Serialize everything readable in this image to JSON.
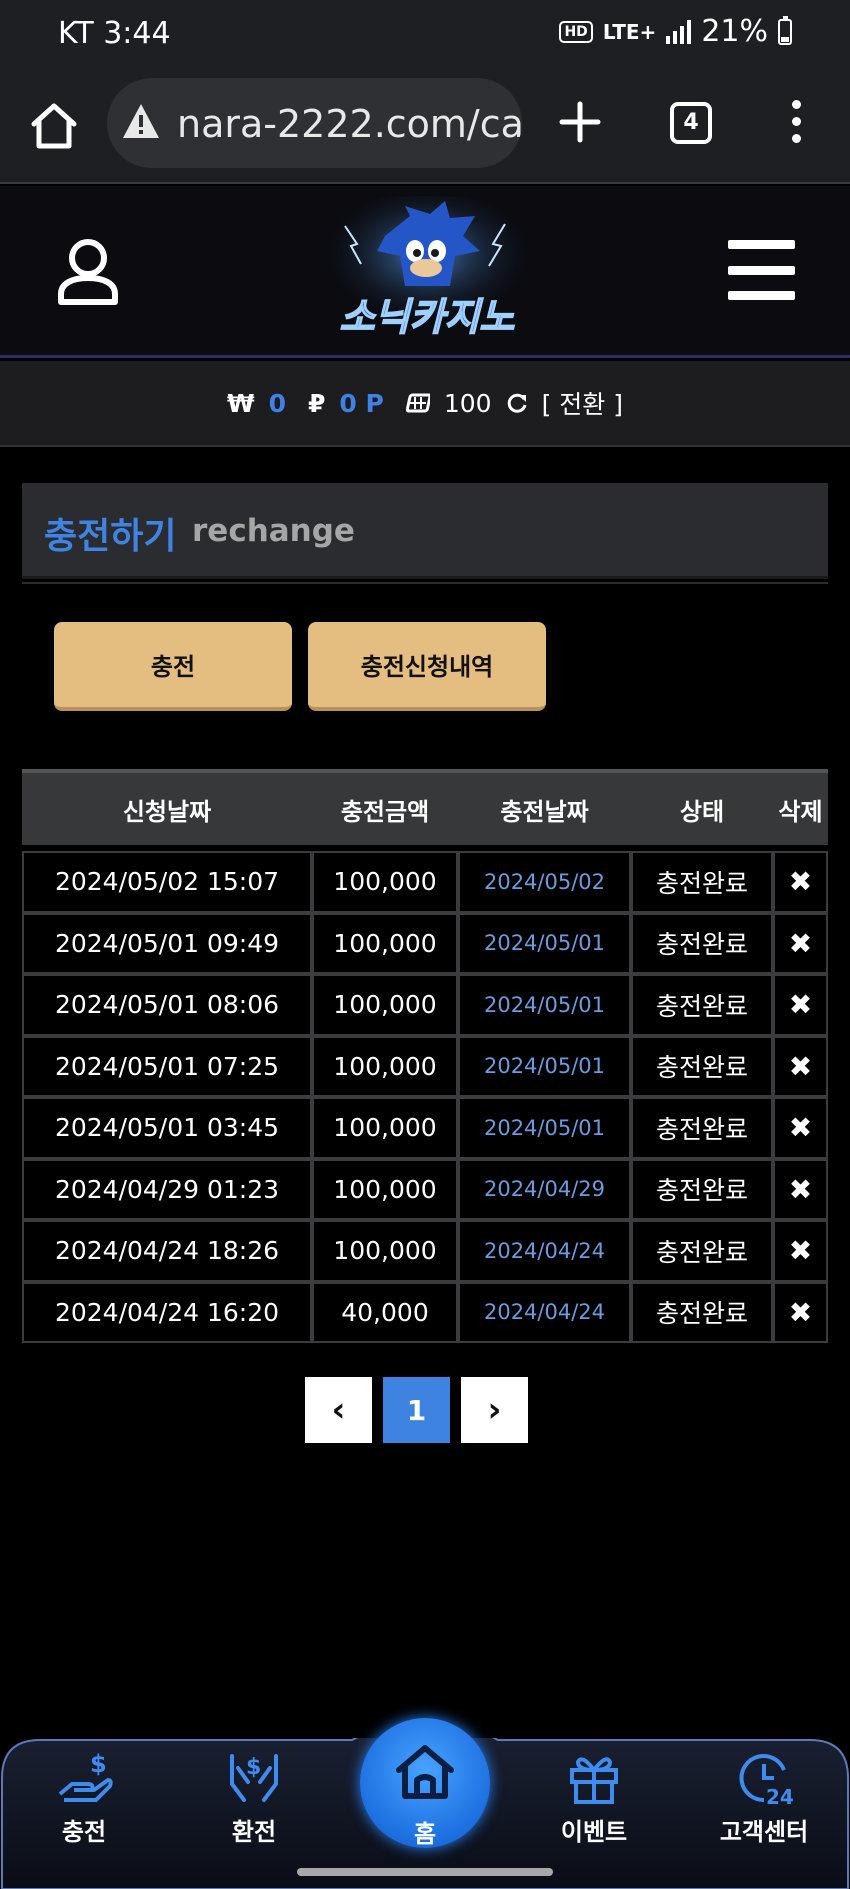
{
  "statusbar": {
    "carrier_time": "KT 3:44",
    "hd": "HD",
    "network": "LTE+",
    "battery": "21%"
  },
  "browser": {
    "url": "nara-2222.com/ca",
    "tab_count": "4"
  },
  "header": {
    "logo_text": "소닉카지노"
  },
  "balance": {
    "won_symbol": "₩",
    "won_value": "0",
    "point_symbol": "₽",
    "point_value": "0 P",
    "chip_value": "100",
    "switch_label": "[ 전환 ]"
  },
  "section": {
    "title_ko": "충전하기",
    "title_en": "rechange"
  },
  "tabs": [
    {
      "label": "충전"
    },
    {
      "label": "충전신청내역"
    }
  ],
  "table": {
    "headers": [
      "신청날짜",
      "충전금액",
      "충전날짜",
      "상태",
      "삭제"
    ],
    "rows": [
      {
        "request_date": "2024/05/02 15:07",
        "amount": "100,000",
        "charge_date": "2024/05/02",
        "status": "충전완료",
        "delete": "✖"
      },
      {
        "request_date": "2024/05/01 09:49",
        "amount": "100,000",
        "charge_date": "2024/05/01",
        "status": "충전완료",
        "delete": "✖"
      },
      {
        "request_date": "2024/05/01 08:06",
        "amount": "100,000",
        "charge_date": "2024/05/01",
        "status": "충전완료",
        "delete": "✖"
      },
      {
        "request_date": "2024/05/01 07:25",
        "amount": "100,000",
        "charge_date": "2024/05/01",
        "status": "충전완료",
        "delete": "✖"
      },
      {
        "request_date": "2024/05/01 03:45",
        "amount": "100,000",
        "charge_date": "2024/05/01",
        "status": "충전완료",
        "delete": "✖"
      },
      {
        "request_date": "2024/04/29 01:23",
        "amount": "100,000",
        "charge_date": "2024/04/29",
        "status": "충전완료",
        "delete": "✖"
      },
      {
        "request_date": "2024/04/24 18:26",
        "amount": "100,000",
        "charge_date": "2024/04/24",
        "status": "충전완료",
        "delete": "✖"
      },
      {
        "request_date": "2024/04/24 16:20",
        "amount": "40,000",
        "charge_date": "2024/04/24",
        "status": "충전완료",
        "delete": "✖"
      }
    ]
  },
  "pagination": {
    "prev": "‹",
    "current": "1",
    "next": "›"
  },
  "bottom_nav": {
    "deposit": "충전",
    "withdraw": "환전",
    "home": "홈",
    "event": "이벤트",
    "support": "고객센터",
    "support_badge": "24"
  },
  "colors": {
    "accent": "#3f84e5",
    "button": "#e4bd80",
    "link": "#6d9bdc"
  }
}
